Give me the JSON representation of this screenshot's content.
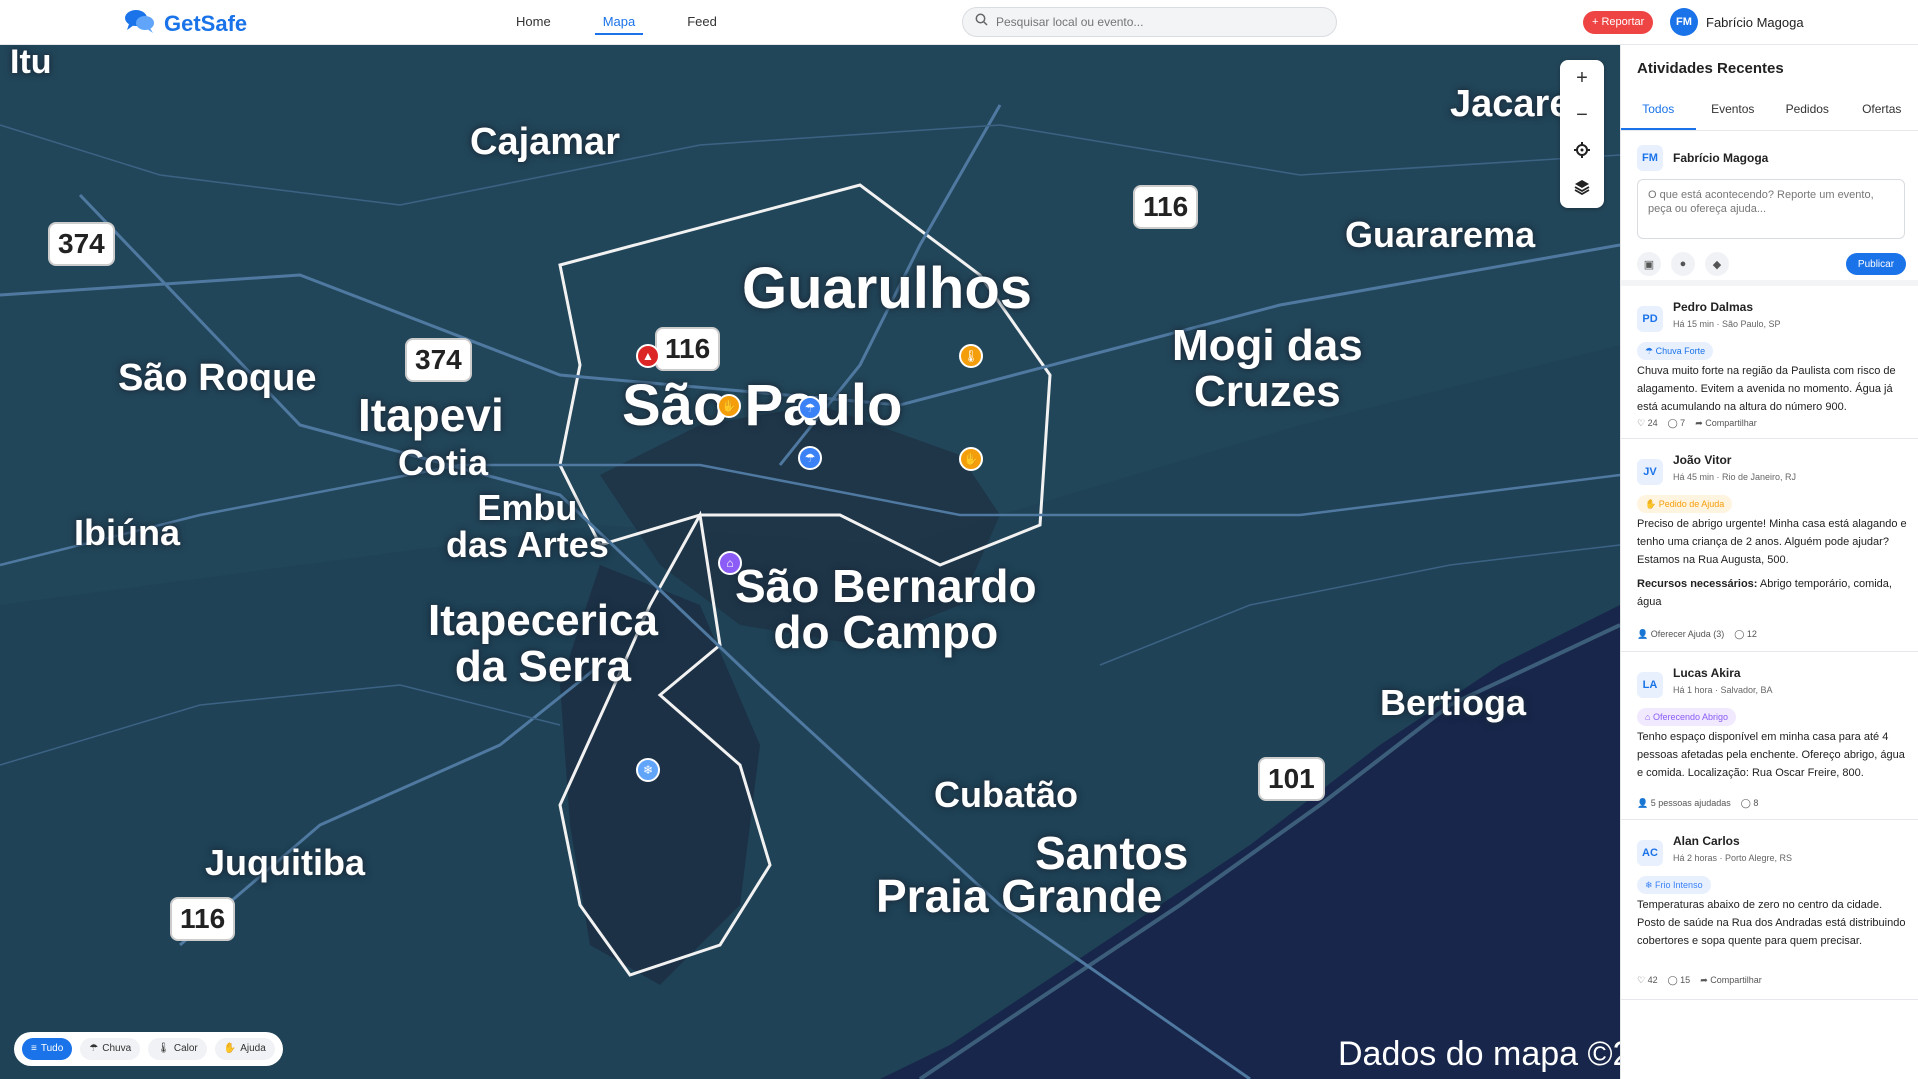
{
  "header": {
    "app_name": "GetSafe",
    "nav": [
      "Home",
      "Mapa",
      "Feed"
    ],
    "active_nav": "Mapa",
    "search_placeholder": "Pesquisar local ou evento...",
    "report_label": "Reportar",
    "user_initials": "FM",
    "user_name": "Fabrício Magoga"
  },
  "map": {
    "cities": {
      "itu": "Itu",
      "cajamar": "Cajamar",
      "jacarei": "Jacare",
      "guararema": "Guararema",
      "guarulhos": "Guarulhos",
      "mogi": "Mogi das\nCruzes",
      "sao_roque": "São Roque",
      "itapevi": "Itapevi",
      "cotia": "Cotia",
      "sao_paulo": "São Paulo",
      "embu": "Embu\ndas Artes",
      "ibiuna": "Ibiúna",
      "sbc": "São Bernardo\ndo Campo",
      "itapecerica": "Itapecerica\nda Serra",
      "bertioga": "Bertioga",
      "cubatao": "Cubatão",
      "santos": "Santos",
      "praia_grande": "Praia Grande",
      "juquitiba": "Juquitiba"
    },
    "highways": {
      "h374a": "374",
      "h374b": "374",
      "h116a": "116",
      "h116b": "116",
      "h116c": "116",
      "h101": "101"
    },
    "attribution": "Dados do mapa ©2",
    "controls": {
      "zoom_in": "+",
      "zoom_out": "−"
    },
    "filters": [
      {
        "label": "Tudo",
        "icon": "layers-icon"
      },
      {
        "label": "Chuva",
        "icon": "rain-icon"
      },
      {
        "label": "Calor",
        "icon": "thermometer-icon"
      },
      {
        "label": "Ajuda",
        "icon": "hand-icon"
      }
    ],
    "active_filter": "Tudo",
    "marker_colors": {
      "alert": "#dc2626",
      "heat": "#f59e0b",
      "rain": "#3b82f6",
      "shelter": "#8b5cf6",
      "cold": "#60a5fa"
    }
  },
  "sidebar": {
    "title": "Atividades Recentes",
    "tabs": [
      "Todos",
      "Eventos",
      "Pedidos",
      "Ofertas"
    ],
    "active_tab": "Todos",
    "composer": {
      "user_initials": "FM",
      "user_name": "Fabrício Magoga",
      "placeholder": "O que está acontecendo? Reporte um evento, peça ou ofereça ajuda...",
      "publish_label": "Publicar"
    },
    "posts": [
      {
        "initials": "PD",
        "name": "Pedro Dalmas",
        "meta": "Há 15 min · São Paulo, SP",
        "tag": "Chuva Forte",
        "tag_icon": "rain-icon",
        "body": "Chuva muito forte na região da Paulista com risco de alagamento. Evitem a avenida no momento. Água já está acumulando na altura do número 900.",
        "likes": "24",
        "comments": "7",
        "share": "Compartilhar"
      },
      {
        "initials": "JV",
        "name": "João Vitor",
        "meta": "Há 45 min · Rio de Janeiro, RJ",
        "tag": "Pedido de Ajuda",
        "tag_icon": "hand-icon",
        "body": "Preciso de abrigo urgente! Minha casa está alagando e tenho uma criança de 2 anos. Alguém pode ajudar? Estamos na Rua Augusta, 500.",
        "resources_label": "Recursos necessários:",
        "resources": "Abrigo temporário, comida, água",
        "help_label": "Oferecer Ajuda (3)",
        "comments": "12"
      },
      {
        "initials": "LA",
        "name": "Lucas Akira",
        "meta": "Há 1 hora · Salvador, BA",
        "tag": "Oferecendo Abrigo",
        "tag_icon": "home-icon",
        "body": "Tenho espaço disponível em minha casa para até 4 pessoas afetadas pela enchente. Ofereço abrigo, água e comida. Localização: Rua Oscar Freire, 800.",
        "helped_label": "5 pessoas ajudadas",
        "comments": "8"
      },
      {
        "initials": "AC",
        "name": "Alan Carlos",
        "meta": "Há 2 horas · Porto Alegre, RS",
        "tag": "Frio Intenso",
        "tag_icon": "snowflake-icon",
        "body": "Temperaturas abaixo de zero no centro da cidade. Posto de saúde na Rua dos Andradas está distribuindo cobertores e sopa quente para quem precisar.",
        "likes": "42",
        "comments": "15",
        "share": "Compartilhar"
      }
    ]
  }
}
